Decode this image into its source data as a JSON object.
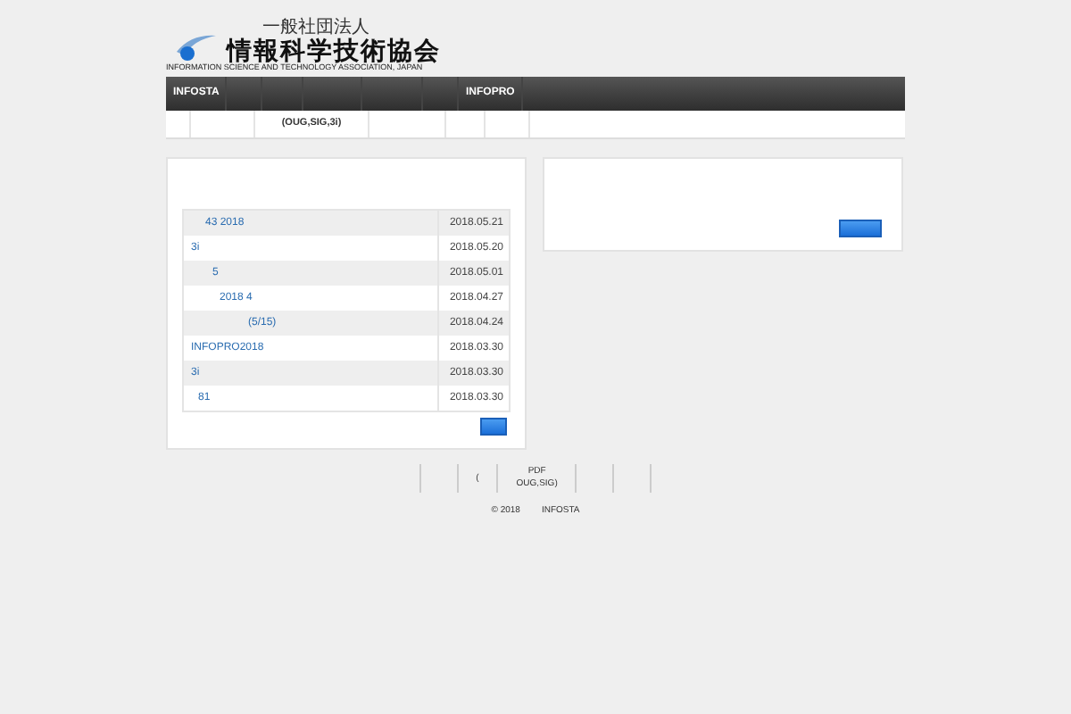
{
  "header": {
    "org_type": "一般社団法人",
    "org_name": "情報科学技術協会",
    "org_name_en": "INFORMATION SCIENCE AND TECHNOLOGY ASSOCIATION, JAPAN"
  },
  "nav": [
    {
      "kind": "link",
      "label": "INFOSTA"
    },
    {
      "kind": "blank"
    },
    {
      "kind": "blank"
    },
    {
      "kind": "blank"
    },
    {
      "kind": "blank"
    },
    {
      "kind": "blank"
    },
    {
      "kind": "link",
      "label": "INFOPRO"
    },
    {
      "kind": "blank"
    }
  ],
  "subnav": [
    {
      "kind": "blank"
    },
    {
      "kind": "blank"
    },
    {
      "kind": "link",
      "label": "(OUG,SIG,3i)"
    },
    {
      "kind": "blank"
    },
    {
      "kind": "blank"
    },
    {
      "kind": "blank"
    },
    {
      "kind": "blank"
    }
  ],
  "news": [
    {
      "title": "43  2018",
      "date": "2018.05.21"
    },
    {
      "title": "3i",
      "date": "2018.05.20"
    },
    {
      "title": "5",
      "date": "2018.05.01"
    },
    {
      "title": "2018 4",
      "date": "2018.04.27"
    },
    {
      "title": "(5/15)",
      "date": "2018.04.24"
    },
    {
      "title": "INFOPRO2018",
      "date": "2018.03.30"
    },
    {
      "title": "3i",
      "date": "2018.03.30"
    },
    {
      "title": "81",
      "date": "2018.03.30"
    }
  ],
  "footer": {
    "links": [
      {
        "kind": "blank"
      },
      {
        "kind": "blank"
      },
      {
        "kind": "link",
        "lines": [
          "("
        ]
      },
      {
        "kind": "link",
        "lines": [
          "PDF",
          "OUG,SIG)"
        ]
      },
      {
        "kind": "blank"
      },
      {
        "kind": "blank"
      },
      {
        "kind": "blank"
      }
    ],
    "copyright": "© 2018",
    "owner": "INFOSTA"
  }
}
